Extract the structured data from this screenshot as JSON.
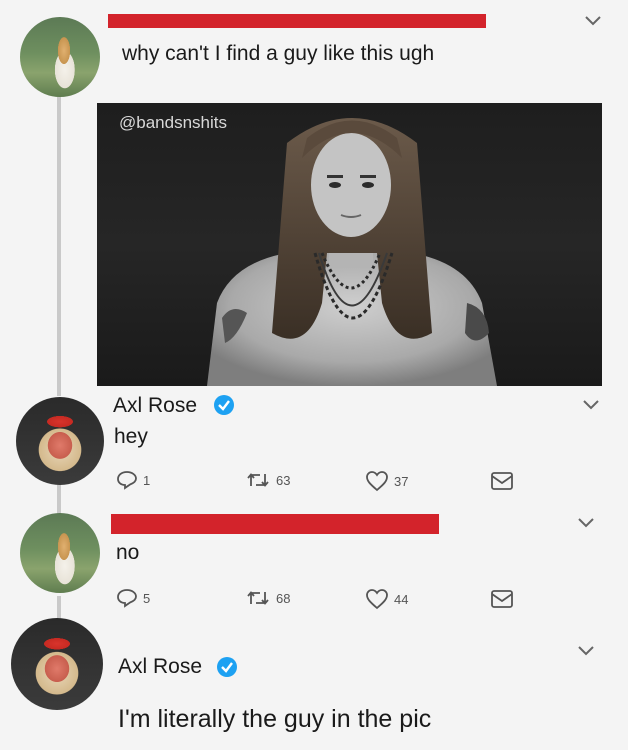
{
  "tweets": [
    {
      "author": "",
      "text": "why can't I find a guy like this ugh",
      "image": {
        "watermark": "@bandsnshits"
      }
    },
    {
      "author": "Axl Rose",
      "verified": true,
      "text": "hey",
      "reply_count": "1",
      "retweet_count": "63",
      "like_count": "37"
    },
    {
      "author": "",
      "text": "no",
      "reply_count": "5",
      "retweet_count": "68",
      "like_count": "44"
    },
    {
      "author": "Axl Rose",
      "verified": true,
      "text": "I'm literally the guy in the pic"
    }
  ],
  "colors": {
    "redaction": "#d3232b",
    "verified": "#1da1f2",
    "background": "#f4f4f4"
  },
  "icons": [
    "reply-icon",
    "retweet-icon",
    "like-icon",
    "dm-icon",
    "chevron-down-icon",
    "verified-badge-icon"
  ]
}
